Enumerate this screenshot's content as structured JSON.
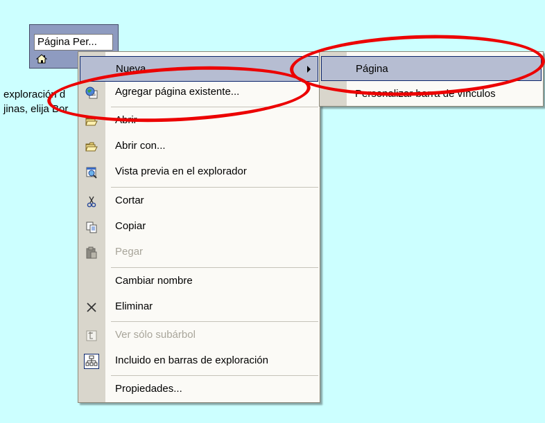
{
  "node": {
    "title": "Página Per..."
  },
  "background": {
    "line1": "exploración d",
    "line2": "jinas, elija Bor"
  },
  "context_menu": {
    "items": [
      {
        "label": "Nueva",
        "icon": "none",
        "has_submenu": true,
        "highlighted": true
      },
      {
        "label": "Agregar página existente...",
        "icon": "globe-page-icon"
      },
      {
        "label": "Abrir",
        "icon": "open-folder-icon"
      },
      {
        "label": "Abrir con...",
        "icon": "open-folder-icon"
      },
      {
        "label": "Vista previa en el explorador",
        "icon": "browser-preview-icon"
      },
      {
        "label": "Cortar",
        "icon": "scissors-icon"
      },
      {
        "label": "Copiar",
        "icon": "copy-icon"
      },
      {
        "label": "Pegar",
        "icon": "paste-icon",
        "disabled": true
      },
      {
        "label": "Cambiar nombre",
        "icon": "none"
      },
      {
        "label": "Eliminar",
        "icon": "delete-x-icon"
      },
      {
        "label": "Ver sólo subárbol",
        "icon": "subtree-icon",
        "disabled": true
      },
      {
        "label": "Incluido en barras de exploración",
        "icon": "hierarchy-icon",
        "checked": true
      },
      {
        "label": "Propiedades...",
        "icon": "none"
      }
    ]
  },
  "submenu": {
    "items": [
      {
        "label": "Página",
        "highlighted": true
      },
      {
        "label": "Personalizar barra de vínculos"
      }
    ]
  },
  "annotation_color": "#ec0000"
}
